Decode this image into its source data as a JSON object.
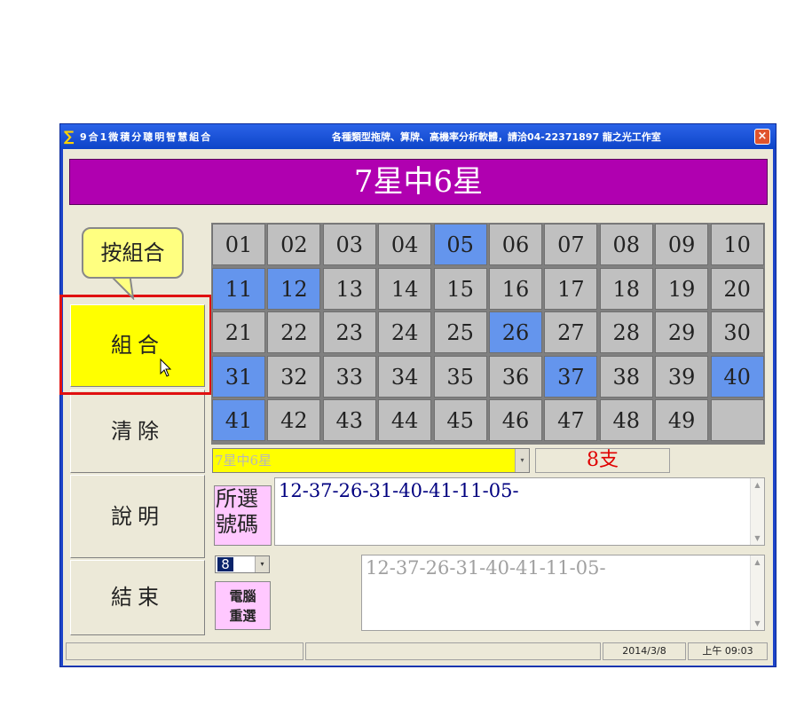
{
  "window": {
    "title_left": "9合1微積分聰明智慧組合",
    "title_right": "各種類型拖牌、算牌、高機率分析軟體，請洽04-22371897 龍之光工作室",
    "close_label": "×",
    "app_icon": "∑"
  },
  "banner": {
    "title": "7星中6星"
  },
  "left_buttons": {
    "combine": "組合",
    "clear": "清除",
    "help": "說明",
    "exit": "結束"
  },
  "callout": {
    "text": "按組合"
  },
  "numbers": {
    "cells": [
      "01",
      "02",
      "03",
      "04",
      "05",
      "06",
      "07",
      "08",
      "09",
      "10",
      "11",
      "12",
      "13",
      "14",
      "15",
      "16",
      "17",
      "18",
      "19",
      "20",
      "21",
      "22",
      "23",
      "24",
      "25",
      "26",
      "27",
      "28",
      "29",
      "30",
      "31",
      "32",
      "33",
      "34",
      "35",
      "36",
      "37",
      "38",
      "39",
      "40",
      "41",
      "42",
      "43",
      "44",
      "45",
      "46",
      "47",
      "48",
      "49",
      ""
    ],
    "selected": [
      "05",
      "11",
      "12",
      "26",
      "31",
      "37",
      "40",
      "41"
    ]
  },
  "mode_select": {
    "value": "7星中6星",
    "arrow": "▾"
  },
  "count": {
    "text": "8支"
  },
  "selected_label": {
    "line1": "所選",
    "line2": "號碼"
  },
  "selected_numbers": "12-37-26-31-40-41-11-05-",
  "number_select": {
    "value": "8",
    "arrow": "▾"
  },
  "reselect_button": {
    "line1": "電腦",
    "line2": "重選"
  },
  "result_numbers": "12-37-26-31-40-41-11-05-",
  "status": {
    "date": "2014/3/8",
    "time": "上午 09:03"
  },
  "colors": {
    "banner": "#b000b0",
    "selected_cell": "#6495ed",
    "cell": "#c0c0c0",
    "combine_button": "#ffff00",
    "count_text": "#e00000",
    "selected_text": "#000080"
  }
}
